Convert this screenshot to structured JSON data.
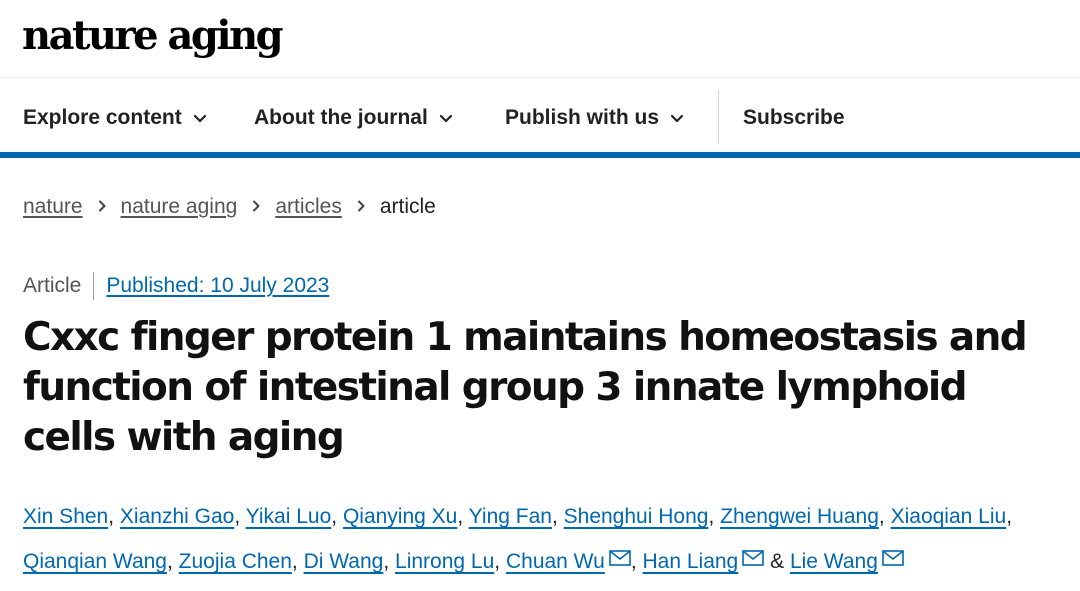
{
  "site": {
    "logo_text": "nature aging"
  },
  "nav": {
    "items": [
      {
        "label": "Explore content"
      },
      {
        "label": "About the journal"
      },
      {
        "label": "Publish with us"
      }
    ],
    "subscribe_label": "Subscribe"
  },
  "breadcrumb": {
    "items": [
      "nature",
      "nature aging",
      "articles"
    ],
    "current": "article"
  },
  "meta": {
    "type": "Article",
    "published": "Published: 10 July 2023"
  },
  "article": {
    "title": "Cxxc finger protein 1 maintains homeostasis and function of intestinal group 3 innate lymphoid cells with aging"
  },
  "authors": {
    "list": [
      "Xin Shen",
      "Xianzhi Gao",
      "Yikai Luo",
      "Qianying Xu",
      "Ying Fan",
      "Shenghui Hong",
      "Zhengwei Huang",
      "Xiaoqian Liu",
      "Qianqian Wang",
      "Zuojia Chen",
      "Di Wang",
      "Linrong Lu",
      "Chuan Wu",
      "Han Liang",
      "Lie Wang"
    ],
    "separator": ",",
    "conjunction": "&"
  },
  "icons": {
    "nav_dropdown": "chevron-down-icon",
    "breadcrumb_separator": "chevron-right-icon",
    "corresponding_author": "mail-icon"
  },
  "colors": {
    "link": "#0067b1",
    "nav_underline": "#0067b1",
    "text": "#222222"
  }
}
